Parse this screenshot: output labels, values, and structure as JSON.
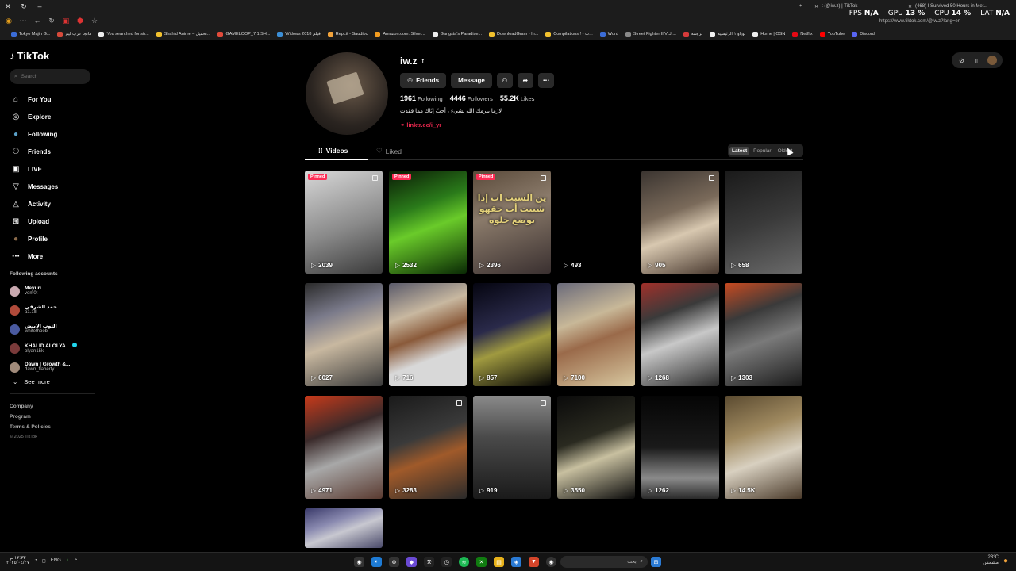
{
  "browser": {
    "tabs": [
      {
        "title": "t (@iw.z) | TikTok"
      },
      {
        "title": "(468) I Survived 50 Hours in Met..."
      }
    ],
    "url": "https://www.tiktok.com/@iw.z?lang=en",
    "perf": {
      "fps_label": "FPS",
      "fps": "N/A",
      "gpu_label": "GPU",
      "gpu": "13 %",
      "cpu_label": "CPU",
      "cpu": "14 %",
      "lat_label": "LAT",
      "lat": "N/A"
    },
    "bookmarks": [
      {
        "label": "Tokyo Majin G...",
        "color": "#3b6cd6"
      },
      {
        "label": "مانجا عرب ليم",
        "color": "#d64a3b"
      },
      {
        "label": "You searched for str...",
        "color": "#eee"
      },
      {
        "label": "Shahid Anime – تحميل...",
        "color": "#f2c12e"
      },
      {
        "label": "GAMELOOP_7.1 SH...",
        "color": "#e14b3b"
      },
      {
        "label": "Widows 2018 فيلم",
        "color": "#3b8ed6"
      },
      {
        "label": "RepLit - Saudibc",
        "color": "#f2a33b"
      },
      {
        "label": "Amazon.com: Silver...",
        "color": "#f29c1f"
      },
      {
        "label": "Gangsta's Paradise...",
        "color": "#eee"
      },
      {
        "label": "DownloadGram - In...",
        "color": "#f2c12e"
      },
      {
        "label": "Compilations!! - ب...",
        "color": "#f2c12e"
      },
      {
        "label": "Word",
        "color": "#3b6cd6"
      },
      {
        "label": "Street Fighter II V الـ...",
        "color": "#8a8a8a"
      },
      {
        "label": "ترجمة",
        "color": "#d63b3b"
      },
      {
        "label": "توياو ١ الرئيسية",
        "color": "#eee"
      },
      {
        "label": "Home | OSN",
        "color": "#eee"
      },
      {
        "label": "Netflix",
        "color": "#e50914"
      },
      {
        "label": "YouTube",
        "color": "#ff0000"
      },
      {
        "label": "Discord",
        "color": "#5865f2"
      }
    ]
  },
  "sidebar": {
    "logo": "TikTok",
    "search_placeholder": "Search",
    "nav": [
      {
        "label": "For You",
        "icon": "home-icon",
        "glyph": "⌂"
      },
      {
        "label": "Explore",
        "icon": "compass-icon",
        "glyph": "◎"
      },
      {
        "label": "Following",
        "icon": "following-avatar-icon",
        "glyph": "●"
      },
      {
        "label": "Friends",
        "icon": "friends-icon",
        "glyph": "⚇"
      },
      {
        "label": "LIVE",
        "icon": "live-icon",
        "glyph": "▣"
      },
      {
        "label": "Messages",
        "icon": "messages-icon",
        "glyph": "▽"
      },
      {
        "label": "Activity",
        "icon": "activity-icon",
        "glyph": "◬"
      },
      {
        "label": "Upload",
        "icon": "upload-icon",
        "glyph": "⊞"
      },
      {
        "label": "Profile",
        "icon": "profile-avatar-icon",
        "glyph": "●"
      },
      {
        "label": "More",
        "icon": "more-icon",
        "glyph": "⋯"
      }
    ],
    "following_title": "Following accounts",
    "accounts": [
      {
        "name": "Meyuri",
        "handle": "vom0t",
        "color": "#c9a9b0",
        "verified": false
      },
      {
        "name": "حمد الشرقي",
        "handle": "a1.1lll",
        "color": "#b04a3a",
        "verified": false
      },
      {
        "name": "الثوب الابيض",
        "handle": "whitethoob",
        "color": "#4a5aa0",
        "verified": false
      },
      {
        "name": "KHALID ALOLYA...",
        "handle": "olyan15k",
        "color": "#7a3a3a",
        "verified": true
      },
      {
        "name": "Dawn | Growth &...",
        "handle": "dawn_flaherty",
        "color": "#a08a7a",
        "verified": false
      }
    ],
    "see_more": "See more",
    "footer": [
      "Company",
      "Program",
      "Terms & Policies"
    ],
    "copyright": "© 2025 TikTok"
  },
  "profile": {
    "username": "iw.z",
    "nickname": "t",
    "friends_button": "Friends",
    "message_button": "Message",
    "stats": [
      {
        "value": "1961",
        "label": "Following"
      },
      {
        "value": "4446",
        "label": "Followers"
      },
      {
        "value": "55.2K",
        "label": "Likes"
      }
    ],
    "bio": "لازما يبرمك الله بشيء ، أحبّ إيّاك مما فقدت",
    "link": "linktr.ee/i_yr"
  },
  "tabs": {
    "videos": "Videos",
    "liked": "Liked"
  },
  "sort": {
    "options": [
      "Latest",
      "Popular",
      "Oldest"
    ],
    "active": "Latest"
  },
  "videos": [
    {
      "views": "2039",
      "pinned": true,
      "multi": true,
      "bg": "linear-gradient(160deg,#d8d8d8,#8a8a8a 55%,#3a3a3a)",
      "text": ""
    },
    {
      "views": "2532",
      "pinned": true,
      "multi": false,
      "bg": "linear-gradient(160deg,#0a1a05,#2a7a1a 35%,#6acb2a 55%,#0a2a05)",
      "text": ""
    },
    {
      "views": "2396",
      "pinned": true,
      "multi": true,
      "bg": "linear-gradient(160deg,#5a4a3a,#8a7a6a 40%,#3a3030)",
      "text": "ين السبت اب إذا شبيت أب حقهو بوضع خلوه"
    },
    {
      "views": "493",
      "pinned": false,
      "multi": false,
      "bg": "#000",
      "text": ""
    },
    {
      "views": "905",
      "pinned": false,
      "multi": true,
      "bg": "linear-gradient(160deg,#3a3430,#7a6a5a 40%,#d8c8b0 60%,#4a3a30)",
      "text": ""
    },
    {
      "views": "658",
      "pinned": false,
      "multi": false,
      "bg": "linear-gradient(160deg,#1a1a1a,#3a3a3a 50%,#6a6a6a)",
      "text": ""
    },
    {
      "views": "6027",
      "pinned": false,
      "multi": false,
      "bg": "linear-gradient(160deg,#2a2a2a,#7a7a8a 30%,#c8b8a0 55%,#3a3a3a)",
      "text": ""
    },
    {
      "views": "716",
      "pinned": false,
      "multi": false,
      "bg": "linear-gradient(160deg,#5a5a6a,#c8b8a0 30%,#8a5a3a 50%,#d8d8d8 70%)",
      "text": ""
    },
    {
      "views": "857",
      "pinned": false,
      "multi": false,
      "bg": "linear-gradient(160deg,#050510,#2a2a4a 40%,#a09a40 60%,#050505)",
      "text": ""
    },
    {
      "views": "7100",
      "pinned": false,
      "multi": false,
      "bg": "linear-gradient(160deg,#6a6a7a,#c8b898 35%,#9a6a4a 55%,#d8c8a0)",
      "text": ""
    },
    {
      "views": "1268",
      "pinned": false,
      "multi": false,
      "bg": "linear-gradient(160deg,#a0302a,#3a3a3a 30%,#c8c8c8 55%,#2a2a2a)",
      "text": ""
    },
    {
      "views": "1303",
      "pinned": false,
      "multi": false,
      "bg": "linear-gradient(160deg,#c84a20,#3a3a3a 30%,#7a7a7a 55%,#1a1a1a)",
      "text": ""
    },
    {
      "views": "4971",
      "pinned": false,
      "multi": false,
      "bg": "linear-gradient(160deg,#c83a1a,#3a2a2a 35%,#a8a8a8 60%,#5a3a30)",
      "text": ""
    },
    {
      "views": "3283",
      "pinned": false,
      "multi": true,
      "bg": "linear-gradient(160deg,#1a1a1a,#3a3a3a 40%,#a05a2a 60%,#2a2a2a)",
      "text": ""
    },
    {
      "views": "919",
      "pinned": false,
      "multi": true,
      "bg": "linear-gradient(180deg,#8a8a8a,#4a4a4a 40%,#1a1a1a)",
      "text": ""
    },
    {
      "views": "3550",
      "pinned": false,
      "multi": false,
      "bg": "linear-gradient(160deg,#0a0a0a,#2a2a20 40%,#c8c0a0 60%,#0a0a0a)",
      "text": ""
    },
    {
      "views": "1262",
      "pinned": false,
      "multi": false,
      "bg": "linear-gradient(180deg,#050505,#1a1a1a 50%,#8a8a8a 80%,#2a2a2a)",
      "text": ""
    },
    {
      "views": "14.5K",
      "pinned": false,
      "multi": false,
      "bg": "linear-gradient(160deg,#5a4a30,#a08a60 35%,#d8d0c0 60%,#4a3a2a)",
      "text": ""
    },
    {
      "views": "",
      "pinned": false,
      "multi": false,
      "bg": "linear-gradient(160deg,#3a3a6a,#8a8ab0 35%,#c8c8d0 55%,#4a4a6a)",
      "text": ""
    }
  ],
  "labels": {
    "pinned": "Pinned"
  },
  "taskbar": {
    "clock_time": "١٢:٣٣ م",
    "clock_date": "٢٠٢٥/٠٤/٢٧",
    "lang": "ENG",
    "search_text": "بحث",
    "weather_temp": "23°C",
    "weather_desc": "مشمس"
  }
}
